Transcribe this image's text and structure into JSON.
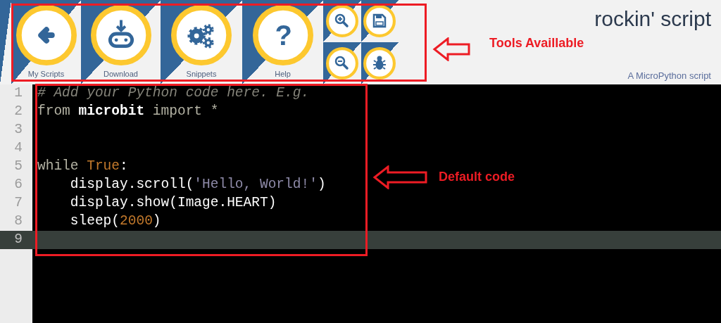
{
  "toolbar": {
    "buttons": [
      {
        "label": "My Scripts"
      },
      {
        "label": "Download"
      },
      {
        "label": "Snippets"
      },
      {
        "label": "Help",
        "glyph": "?"
      }
    ]
  },
  "script": {
    "title": "rockin' script",
    "subtitle": "A MicroPython script"
  },
  "editor": {
    "lines": [
      {
        "number": "1",
        "active": false,
        "tokens": [
          {
            "kind": "comment",
            "text": "# Add your Python code here. E.g."
          }
        ]
      },
      {
        "number": "2",
        "active": false,
        "tokens": [
          {
            "kind": "keyword",
            "text": "from "
          },
          {
            "kind": "module",
            "text": "microbit"
          },
          {
            "kind": "keyword",
            "text": " import *"
          }
        ]
      },
      {
        "number": "3",
        "active": false
      },
      {
        "number": "4",
        "active": false
      },
      {
        "number": "5",
        "active": false,
        "tokens": [
          {
            "kind": "keyword",
            "text": "while "
          },
          {
            "kind": "constant",
            "text": "True"
          },
          {
            "kind": "plain",
            "text": ":"
          }
        ]
      },
      {
        "number": "6",
        "active": false,
        "tokens": [
          {
            "kind": "plain",
            "text": "    display.scroll("
          },
          {
            "kind": "string",
            "text": "'Hello, World!'"
          },
          {
            "kind": "plain",
            "text": ")"
          }
        ]
      },
      {
        "number": "7",
        "active": false,
        "tokens": [
          {
            "kind": "plain",
            "text": "    display.show(Image.HEART)"
          }
        ]
      },
      {
        "number": "8",
        "active": false,
        "tokens": [
          {
            "kind": "plain",
            "text": "    sleep("
          },
          {
            "kind": "constant",
            "text": "2000"
          },
          {
            "kind": "plain",
            "text": ")"
          }
        ]
      },
      {
        "number": "9",
        "active": true
      }
    ]
  },
  "annotations": [
    {
      "kind": "tools",
      "label": "Tools Availlable"
    },
    {
      "kind": "code",
      "label": "Default code"
    }
  ]
}
